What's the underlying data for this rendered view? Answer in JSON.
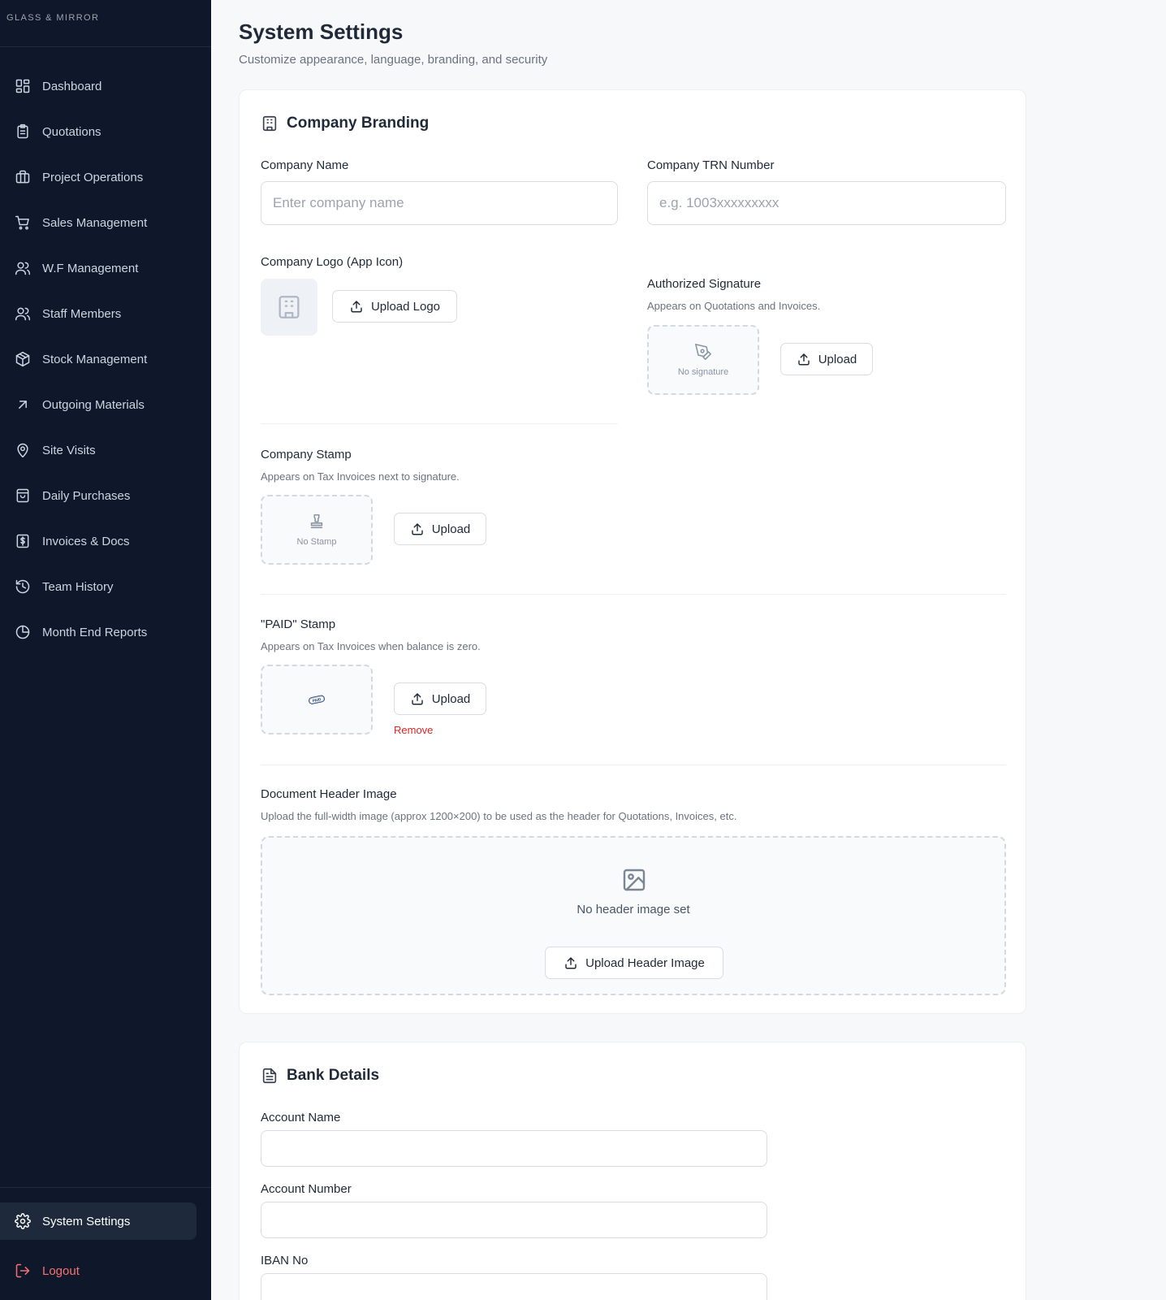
{
  "brand": {
    "name": "GLASS & MIRROR"
  },
  "sidebar": {
    "items": [
      {
        "label": "Dashboard"
      },
      {
        "label": "Quotations"
      },
      {
        "label": "Project Operations"
      },
      {
        "label": "Sales Management"
      },
      {
        "label": "W.F Management"
      },
      {
        "label": "Staff Members"
      },
      {
        "label": "Stock Management"
      },
      {
        "label": "Outgoing Materials"
      },
      {
        "label": "Site Visits"
      },
      {
        "label": "Daily Purchases"
      },
      {
        "label": "Invoices & Docs"
      },
      {
        "label": "Team History"
      },
      {
        "label": "Month End Reports"
      }
    ],
    "settings_label": "System Settings",
    "logout_label": "Logout"
  },
  "page": {
    "title": "System Settings",
    "subtitle": "Customize appearance, language, branding, and security"
  },
  "branding": {
    "title": "Company Branding",
    "company_name": {
      "label": "Company Name",
      "placeholder": "Enter company name",
      "value": ""
    },
    "trn": {
      "label": "Company TRN Number",
      "placeholder": "e.g. 1003xxxxxxxxx",
      "value": ""
    },
    "logo": {
      "label": "Company Logo (App Icon)",
      "button": "Upload Logo"
    },
    "signature": {
      "label": "Authorized Signature",
      "help": "Appears on Quotations and Invoices.",
      "empty": "No signature",
      "button": "Upload"
    },
    "stamp": {
      "label": "Company Stamp",
      "help": "Appears on Tax Invoices next to signature.",
      "empty": "No Stamp",
      "button": "Upload"
    },
    "paid_stamp": {
      "label": "\"PAID\" Stamp",
      "help": "Appears on Tax Invoices when balance is zero.",
      "stamp_text": "PAID",
      "button": "Upload",
      "remove": "Remove"
    },
    "header_image": {
      "label": "Document Header Image",
      "help": "Upload the full-width image (approx 1200×200) to be used as the header for Quotations, Invoices, etc.",
      "empty": "No header image set",
      "button": "Upload Header Image"
    }
  },
  "bank": {
    "title": "Bank Details",
    "account_name": {
      "label": "Account Name",
      "value": ""
    },
    "account_number": {
      "label": "Account Number",
      "value": ""
    },
    "iban": {
      "label": "IBAN No",
      "value": ""
    }
  },
  "colors": {
    "sidebar_bg": "#0f172a",
    "logout": "#f87171",
    "remove": "#dc2626",
    "paid_stamp": "#1e3a6e"
  }
}
